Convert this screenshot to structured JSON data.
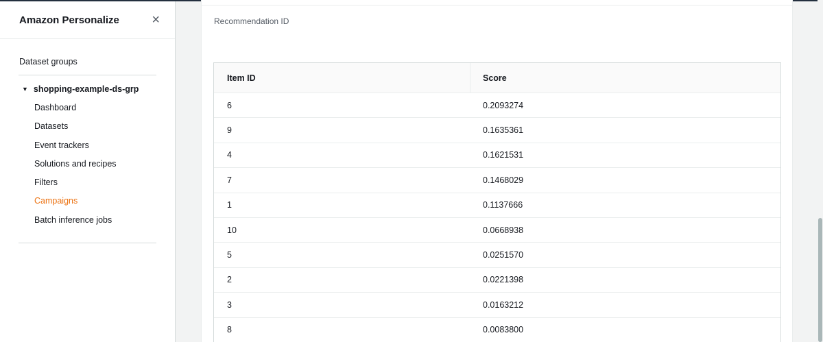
{
  "sidebar": {
    "title": "Amazon Personalize",
    "close_icon": "×",
    "section_label": "Dataset groups",
    "group": {
      "caret": "▼",
      "name": "shopping-example-ds-grp"
    },
    "items": [
      {
        "label": "Dashboard",
        "active": false
      },
      {
        "label": "Datasets",
        "active": false
      },
      {
        "label": "Event trackers",
        "active": false
      },
      {
        "label": "Solutions and recipes",
        "active": false
      },
      {
        "label": "Filters",
        "active": false
      },
      {
        "label": "Campaigns",
        "active": true
      },
      {
        "label": "Batch inference jobs",
        "active": false
      }
    ]
  },
  "main": {
    "field_label": "Recommendation ID",
    "table": {
      "columns": [
        "Item ID",
        "Score"
      ],
      "rows": [
        [
          "6",
          "0.2093274"
        ],
        [
          "9",
          "0.1635361"
        ],
        [
          "4",
          "0.1621531"
        ],
        [
          "7",
          "0.1468029"
        ],
        [
          "1",
          "0.1137666"
        ],
        [
          "10",
          "0.0668938"
        ],
        [
          "5",
          "0.0251570"
        ],
        [
          "2",
          "0.0221398"
        ],
        [
          "3",
          "0.0163212"
        ],
        [
          "8",
          "0.0083800"
        ]
      ]
    }
  },
  "colors": {
    "accent": "#ec7211",
    "header_bar": "#232f3e",
    "text": "#16191f"
  }
}
